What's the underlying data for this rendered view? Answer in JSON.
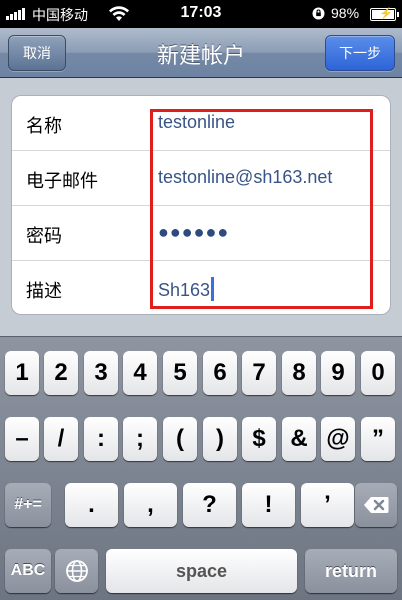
{
  "status_bar": {
    "carrier": "中国移动",
    "time": "17:03",
    "battery_percent": "98%",
    "battery_level": 0.98
  },
  "nav": {
    "title": "新建帐户",
    "cancel_label": "取消",
    "next_label": "下一步"
  },
  "form": {
    "rows": [
      {
        "label": "名称",
        "value": "testonline"
      },
      {
        "label": "电子邮件",
        "value": "testonline@sh163.net"
      },
      {
        "label": "密码",
        "value": "●●●●●●"
      },
      {
        "label": "描述",
        "value": "Sh163"
      }
    ]
  },
  "keyboard": {
    "row1": [
      "1",
      "2",
      "3",
      "4",
      "5",
      "6",
      "7",
      "8",
      "9",
      "0"
    ],
    "row2": [
      "–",
      "/",
      ":",
      ";",
      "(",
      ")",
      "$",
      "&",
      "@",
      "”"
    ],
    "row3_left": "#+=",
    "row3_keys": [
      ".",
      ",",
      "?",
      "!",
      "’"
    ],
    "row4": {
      "abc": "ABC",
      "space": "space",
      "return": "return"
    }
  },
  "icons": {
    "signal": "signal-bars-icon",
    "wifi": "wifi-icon",
    "lock": "orientation-lock-icon",
    "battery": "battery-icon",
    "globe": "globe-icon",
    "delete": "backspace-icon"
  },
  "colors": {
    "highlight_box": "#e01e1e",
    "value_text": "#385487",
    "next_button": "#2d64d8"
  }
}
